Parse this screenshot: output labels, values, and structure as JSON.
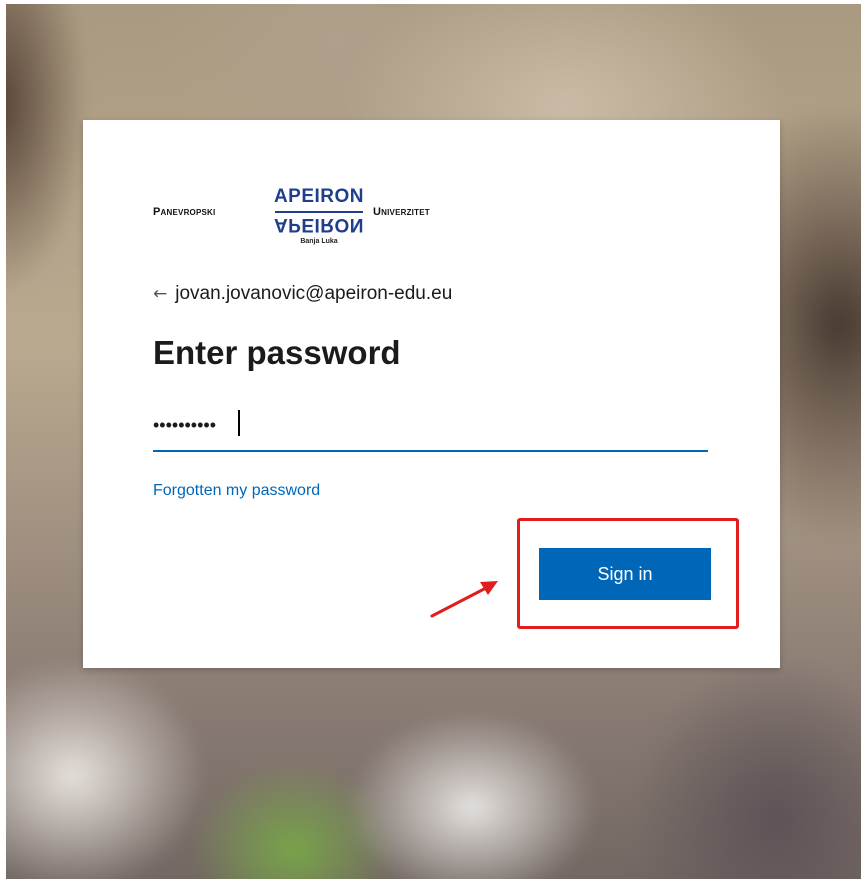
{
  "logo": {
    "left_word": "Panevropski",
    "brand_top": "APEIRON",
    "brand_bottom": "APEIRON",
    "city": "Banja Luka",
    "right_word": "Univerzitet"
  },
  "identity": {
    "back_icon": "back-arrow-icon",
    "email": "jovan.jovanovic@apeiron-edu.eu"
  },
  "title": "Enter password",
  "password": {
    "value": "••••••••••"
  },
  "forgot_link": "Forgotten my password",
  "signin_label": "Sign in",
  "annotation": {
    "highlight_color": "#e01e1e",
    "arrow_icon": "annotation-arrow-icon"
  },
  "colors": {
    "accent": "#0067b8",
    "brand": "#1f3f8c"
  }
}
